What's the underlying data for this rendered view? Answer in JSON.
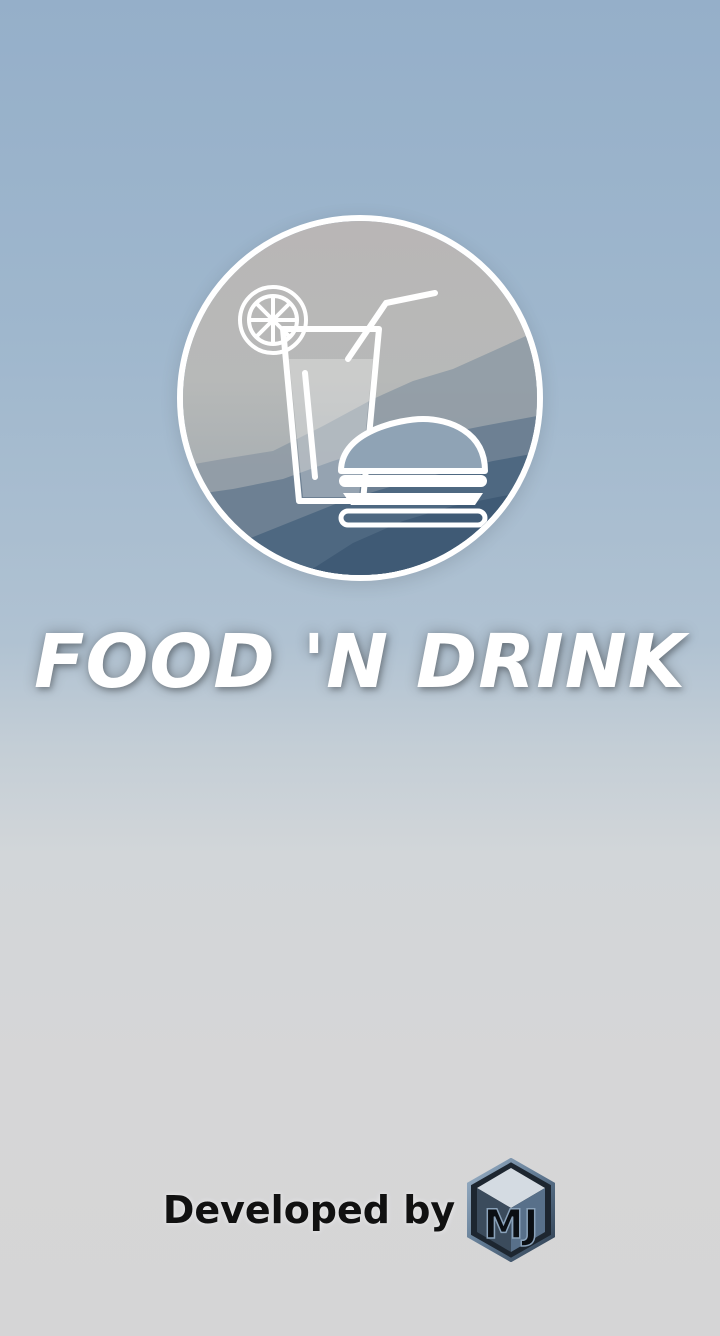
{
  "app": {
    "title": "FOOD 'N DRINK"
  },
  "credit": {
    "label": "Developed by",
    "developer_logo_text": "MJ"
  },
  "icons": {
    "app_logo": "drink-and-burger-icon",
    "developer_logo": "mj-hexagon-logo"
  },
  "colors": {
    "title": "#ffffff",
    "credit_text": "#111111",
    "logo_border": "#ffffff",
    "background_top": "#95afc9",
    "background_bottom": "#d5d5d6"
  }
}
